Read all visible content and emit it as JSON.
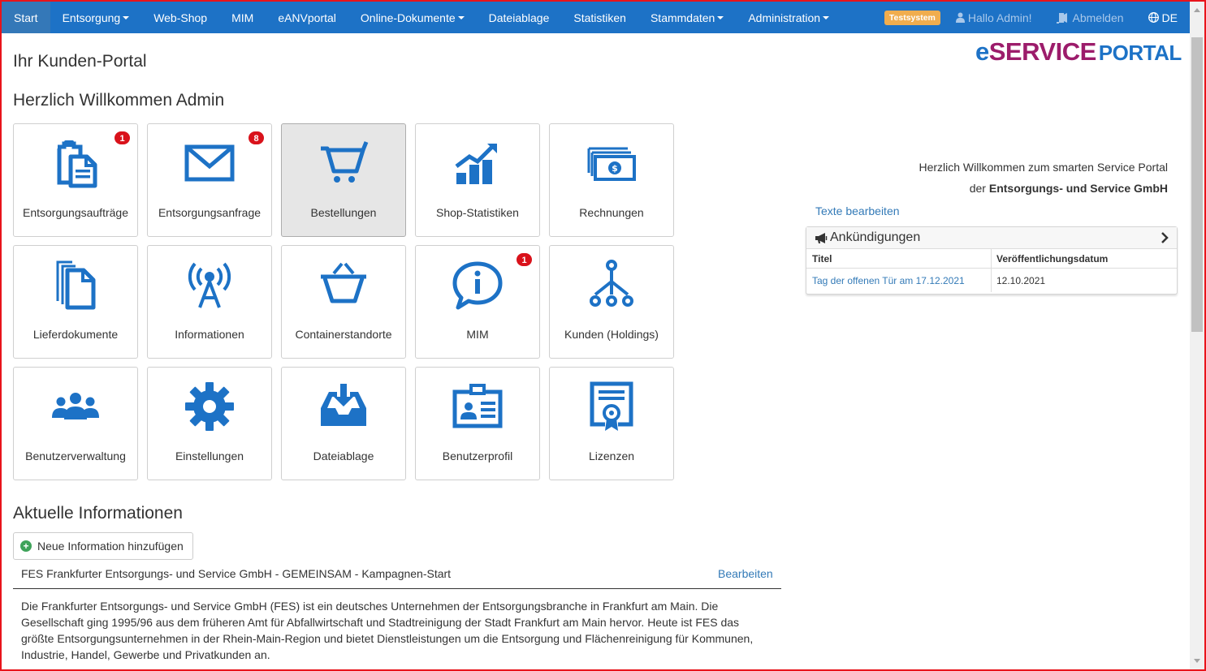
{
  "nav": {
    "items": [
      {
        "label": "Start",
        "active": true,
        "dropdown": false
      },
      {
        "label": "Entsorgung",
        "dropdown": true
      },
      {
        "label": "Web-Shop",
        "dropdown": false
      },
      {
        "label": "MIM",
        "dropdown": false
      },
      {
        "label": "eANVportal",
        "dropdown": false
      },
      {
        "label": "Online-Dokumente",
        "dropdown": true
      },
      {
        "label": "Dateiablage",
        "dropdown": false
      },
      {
        "label": "Statistiken",
        "dropdown": false
      },
      {
        "label": "Stammdaten",
        "dropdown": true
      },
      {
        "label": "Administration",
        "dropdown": true
      }
    ],
    "test_badge": "Testsystem",
    "user_greeting": "Hallo Admin!",
    "logout": "Abmelden",
    "language": "DE"
  },
  "header": {
    "page_title": "Ihr Kunden-Portal",
    "welcome": "Herzlich Willkommen Admin",
    "logo_part1": "e",
    "logo_part2": "SERVICE",
    "logo_part3": "PORTAL"
  },
  "tiles": [
    {
      "label": "Entsorgungsaufträge",
      "icon": "clipboard-document-icon",
      "badge": "1"
    },
    {
      "label": "Entsorgungsanfrage",
      "icon": "envelope-icon",
      "badge": "8"
    },
    {
      "label": "Bestellungen",
      "icon": "shopping-cart-icon",
      "selected": true
    },
    {
      "label": "Shop-Statistiken",
      "icon": "chart-growth-icon"
    },
    {
      "label": "Rechnungen",
      "icon": "money-bills-icon"
    },
    {
      "label": "Lieferdokumente",
      "icon": "documents-stack-icon"
    },
    {
      "label": "Informationen",
      "icon": "broadcast-tower-icon"
    },
    {
      "label": "Containerstandorte",
      "icon": "basket-icon"
    },
    {
      "label": "MIM",
      "icon": "info-bubble-icon",
      "badge": "1"
    },
    {
      "label": "Kunden (Holdings)",
      "icon": "hierarchy-icon"
    },
    {
      "label": "Benutzerverwaltung",
      "icon": "users-group-icon"
    },
    {
      "label": "Einstellungen",
      "icon": "gear-icon"
    },
    {
      "label": "Dateiablage",
      "icon": "inbox-download-icon"
    },
    {
      "label": "Benutzerprofil",
      "icon": "id-card-icon"
    },
    {
      "label": "Lizenzen",
      "icon": "certificate-icon"
    }
  ],
  "intro": {
    "line1": "Herzlich Willkommen zum smarten Service Portal",
    "line2_prefix": "der",
    "line2_company": "Entsorgungs- und Service GmbH",
    "edit_texts": "Texte bearbeiten"
  },
  "announcements": {
    "title": "Ankündigungen",
    "columns": [
      "Titel",
      "Veröffentlichungsdatum"
    ],
    "rows": [
      {
        "title": "Tag der offenen Tür am 17.12.2021",
        "date": "12.10.2021"
      }
    ]
  },
  "news": {
    "title": "Aktuelle Informationen",
    "add_button": "Neue Information hinzufügen",
    "item_title": "FES Frankfurter Entsorgungs- und Service GmbH - GEMEINSAM - Kampagnen-Start",
    "edit": "Bearbeiten",
    "body": "Die Frankfurter Entsorgungs- und Service GmbH (FES) ist ein deutsches Unternehmen der Entsorgungsbranche in Frankfurt am Main. Die Gesellschaft ging 1995/96 aus dem früheren Amt für Abfallwirtschaft und Stadtreinigung der Stadt Frankfurt am Main hervor. Heute ist FES das größte Entsorgungsunternehmen in der Rhein-Main-Region und bietet Dienstleistungen um die Entsorgung und Flächenreinigung für Kommunen, Industrie, Handel, Gewerbe und Privatkunden an."
  },
  "colors": {
    "nav_bg": "#1d72c6",
    "accent": "#1d72c6",
    "badge": "#d9121b",
    "test_badge": "#f0ad4e",
    "logo_magenta": "#9c1c6b"
  }
}
